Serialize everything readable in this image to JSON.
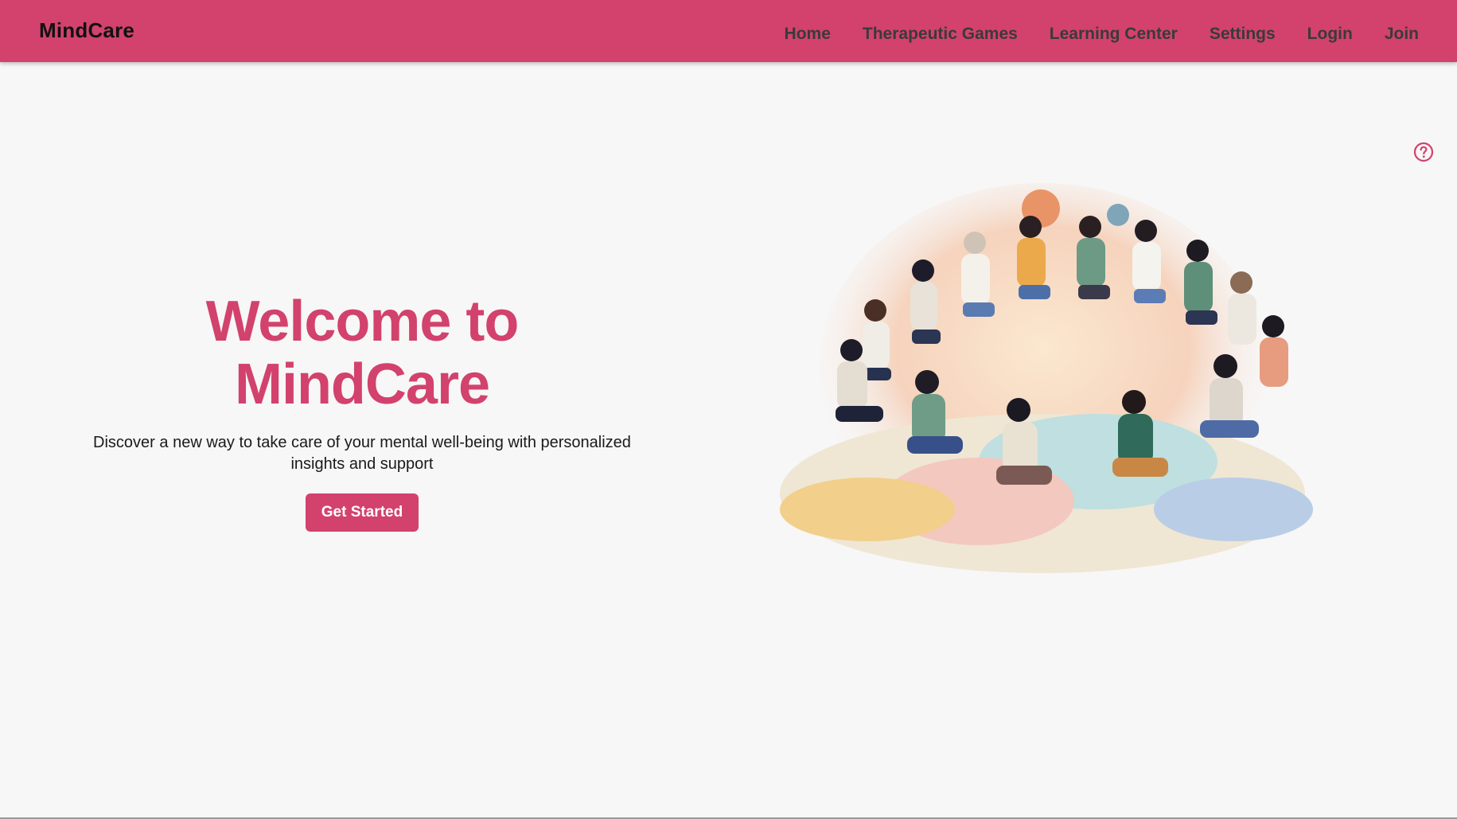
{
  "header": {
    "brand": "MindCare",
    "nav": [
      {
        "label": "Home"
      },
      {
        "label": "Therapeutic Games"
      },
      {
        "label": "Learning Center"
      },
      {
        "label": "Settings"
      },
      {
        "label": "Login"
      },
      {
        "label": "Join"
      }
    ]
  },
  "hero": {
    "title": "Welcome to MindCare",
    "subtitle": "Discover a new way to take care of your mental well-being with personalized insights and support",
    "cta_label": "Get Started"
  },
  "help": {
    "icon": "help-circle-icon"
  },
  "colors": {
    "brand": "#d2426d",
    "background": "#f7f7f7"
  }
}
